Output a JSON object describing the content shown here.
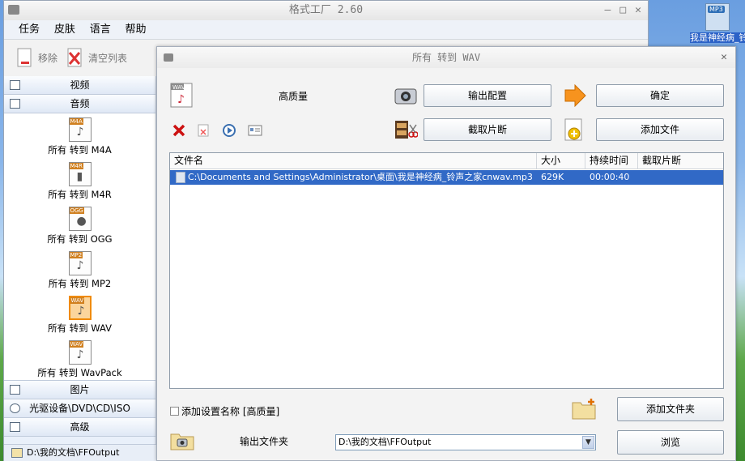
{
  "desktop_icon": {
    "badge": "MP3",
    "label": "我是神经病_铃声之家"
  },
  "main_window": {
    "title": "格式工厂 2.60",
    "menu": [
      "任务",
      "皮肤",
      "语言",
      "帮助"
    ],
    "toolbar": {
      "remove_label": "移除",
      "clear_label": "清空列表"
    },
    "categories": {
      "video": "视频",
      "audio": "音频",
      "picture": "图片",
      "rom": "光驱设备\\DVD\\CD\\ISO",
      "advanced": "高级"
    },
    "formats": [
      {
        "badge": "M4A",
        "label": "所有 转到 M4A"
      },
      {
        "badge": "M4R",
        "label": "所有 转到 M4R"
      },
      {
        "badge": "OGG",
        "label": "所有 转到 OGG"
      },
      {
        "badge": "MP2",
        "label": "所有 转到 MP2"
      },
      {
        "badge": "WAV",
        "label": "所有 转到 WAV"
      },
      {
        "badge": "WAV",
        "label": "所有 转到 WavPack"
      }
    ],
    "status_path": "D:\\我的文档\\FFOutput"
  },
  "dialog": {
    "title": "所有 转到 WAV",
    "quality_label": "高质量",
    "output_config_button": "输出配置",
    "ok_button": "确定",
    "clip_button": "截取片断",
    "add_file_button": "添加文件",
    "columns": [
      "文件名",
      "大小",
      "持续时间",
      "截取片断"
    ],
    "files": [
      {
        "name": "C:\\Documents and Settings\\Administrator\\桌面\\我是神经病_铃声之家cnwav.mp3",
        "size": "629K",
        "duration": "00:00:40",
        "clip": ""
      }
    ],
    "add_setting_label": "添加设置名称 [高质量]",
    "add_folder_button": "添加文件夹",
    "output_folder_label": "输出文件夹",
    "output_path": "D:\\我的文档\\FFOutput",
    "browse_button": "浏览"
  }
}
